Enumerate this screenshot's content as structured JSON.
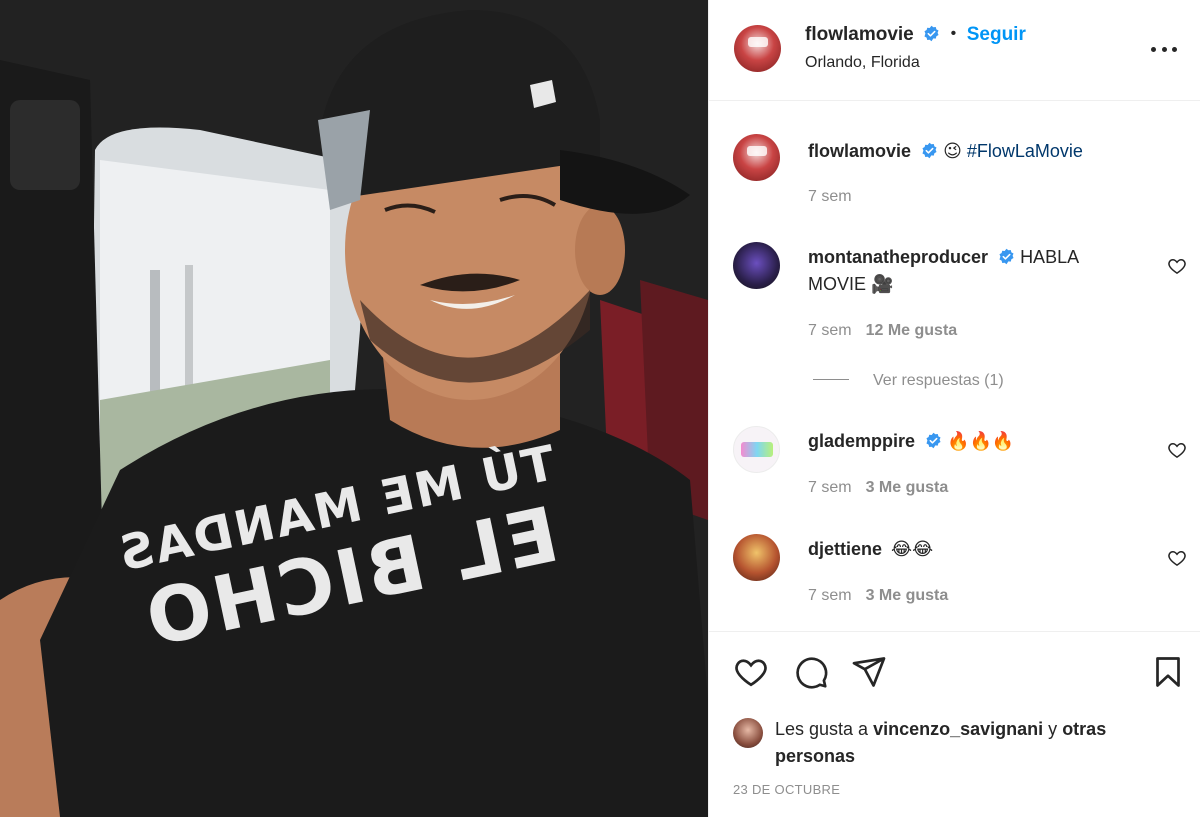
{
  "post": {
    "author": "flowlamovie",
    "location": "Orlando, Florida",
    "follow_label": "Seguir",
    "separator": "•",
    "caption": {
      "username": "flowlamovie",
      "emoji": "😉",
      "hashtag": "#FlowLaMovie",
      "time": "7 sem"
    },
    "comments": [
      {
        "username": "montanatheproducer",
        "verified": true,
        "text": "HABLA MOVIE 🎥",
        "time": "7 sem",
        "likes": "12 Me gusta"
      },
      {
        "username": "glademppire",
        "verified": true,
        "text": "🔥🔥🔥",
        "time": "7 sem",
        "likes": "3 Me gusta"
      },
      {
        "username": "djettiene",
        "verified": false,
        "text": "😂😂",
        "time": "7 sem",
        "likes": "3 Me gusta"
      }
    ],
    "view_replies": "Ver respuestas (1)",
    "liked_by_prefix": "Les gusta a",
    "liked_by_user": "vincenzo_savignani",
    "liked_by_suffix": "y",
    "liked_by_others": "otras personas",
    "date": "23 DE OCTUBRE"
  },
  "photo": {
    "shirt_line1": "TÚ ME MANDAS",
    "shirt_line2": "EL BICHO"
  },
  "colors": {
    "accent": "#0095f6",
    "verified": "#3897f0",
    "text": "#262626",
    "muted": "#8e8e8e",
    "border": "#efefef"
  },
  "icons": [
    "verified-icon",
    "more-icon",
    "heart-icon",
    "comment-icon",
    "share-icon",
    "bookmark-icon"
  ]
}
